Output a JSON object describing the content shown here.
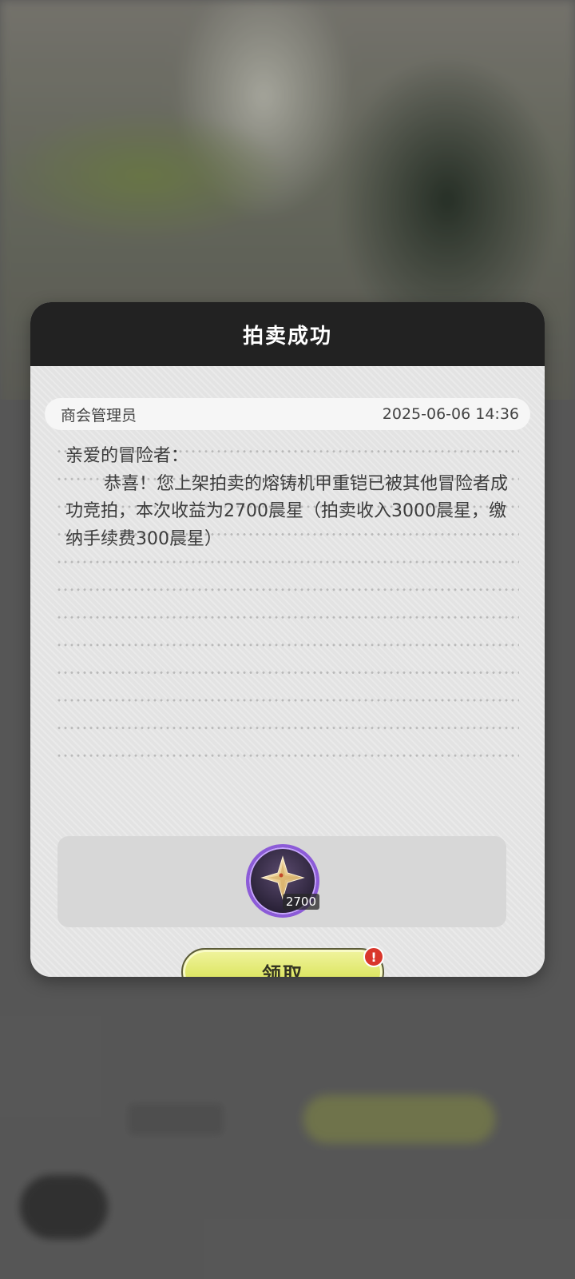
{
  "dialog": {
    "title": "拍卖成功",
    "sender": "商会管理员",
    "timestamp": "2025-06-06 14:36",
    "greeting": "亲爱的冒险者：",
    "body": "恭喜！您上架拍卖的熔铸机甲重铠已被其他冒险者成功竞拍，本次收益为2700晨星（拍卖收入3000晨星，缴纳手续费300晨星）",
    "reward": {
      "icon": "morning-star-currency-icon",
      "count": "2700"
    },
    "claim_button": {
      "label": "领取",
      "badge": "!"
    }
  },
  "colors": {
    "header_bg": "#222222",
    "panel_bg": "#e6e6e6",
    "button_accent": "#dfe76a",
    "badge_red": "#d9362b",
    "reward_ring": "#8c5bd8"
  }
}
